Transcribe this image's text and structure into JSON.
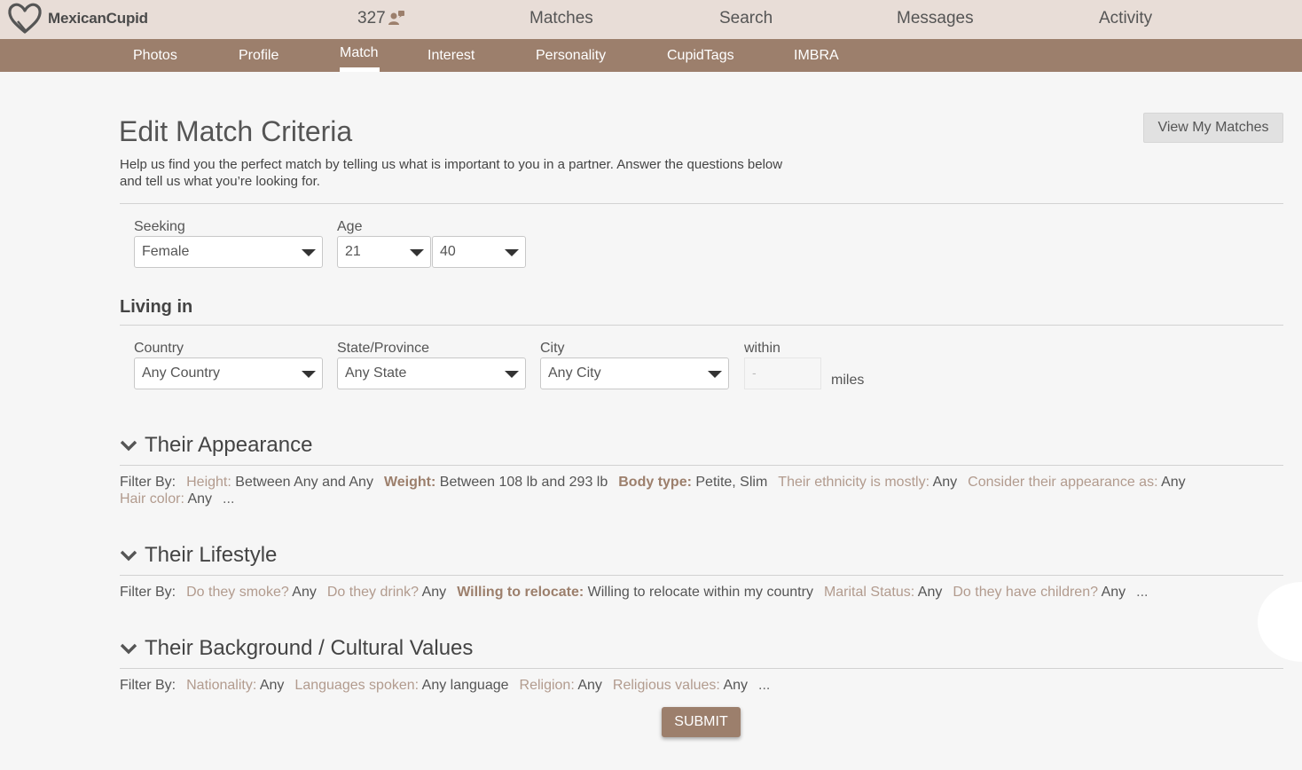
{
  "brand": {
    "name": "MexicanCupid",
    "logo_icon": "heart-icon",
    "accent": "#9c7f6c",
    "topbar_bg": "#e8ddd7"
  },
  "topnav": {
    "count": "327",
    "count_icon": "users-icon",
    "items": [
      "Matches",
      "Search",
      "Messages",
      "Activity"
    ]
  },
  "subnav": {
    "items": [
      "Photos",
      "Profile",
      "Match",
      "Interest",
      "Personality",
      "CupidTags",
      "IMBRA"
    ],
    "active": "Match"
  },
  "header": {
    "title": "Edit Match Criteria",
    "intro": "Help us find you the perfect match by telling us what is important to you in a partner. Answer the questions below and tell us what you’re looking for.",
    "view_matches_label": "View My Matches"
  },
  "seeking": {
    "label": "Seeking",
    "value": "Female"
  },
  "age": {
    "label": "Age",
    "min": "21",
    "max": "40"
  },
  "living": {
    "title": "Living in",
    "country": {
      "label": "Country",
      "value": "Any Country"
    },
    "state": {
      "label": "State/Province",
      "value": "Any State"
    },
    "city": {
      "label": "City",
      "value": "Any City"
    },
    "within": {
      "label": "within",
      "value": "-",
      "unit": "miles"
    }
  },
  "sections": {
    "appearance": {
      "title": "Their Appearance",
      "filter_label": "Filter By:",
      "items": [
        {
          "key": "Height:",
          "value": "Between Any and Any",
          "set": false
        },
        {
          "key": "Weight:",
          "value": "Between 108 lb and 293 lb",
          "set": true
        },
        {
          "key": "Body type:",
          "value": "Petite, Slim",
          "set": true
        },
        {
          "key": "Their ethnicity is mostly:",
          "value": "Any",
          "set": false
        },
        {
          "key": "Consider their appearance as:",
          "value": "Any",
          "set": false
        },
        {
          "key": "Hair color:",
          "value": "Any",
          "set": false
        }
      ],
      "more": "..."
    },
    "lifestyle": {
      "title": "Their Lifestyle",
      "filter_label": "Filter By:",
      "items": [
        {
          "key": "Do they smoke?",
          "value": "Any",
          "set": false
        },
        {
          "key": "Do they drink?",
          "value": "Any",
          "set": false
        },
        {
          "key": "Willing to relocate:",
          "value": "Willing to relocate within my country",
          "set": true
        },
        {
          "key": "Marital Status:",
          "value": "Any",
          "set": false
        },
        {
          "key": "Do they have children?",
          "value": "Any",
          "set": false
        }
      ],
      "more": "..."
    },
    "background": {
      "title": "Their Background / Cultural Values",
      "filter_label": "Filter By:",
      "items": [
        {
          "key": "Nationality:",
          "value": "Any",
          "set": false
        },
        {
          "key": "Languages spoken:",
          "value": "Any language",
          "set": false
        },
        {
          "key": "Religion:",
          "value": "Any",
          "set": false
        },
        {
          "key": "Religious values:",
          "value": "Any",
          "set": false
        }
      ],
      "more": "..."
    }
  },
  "submit_label": "SUBMIT"
}
